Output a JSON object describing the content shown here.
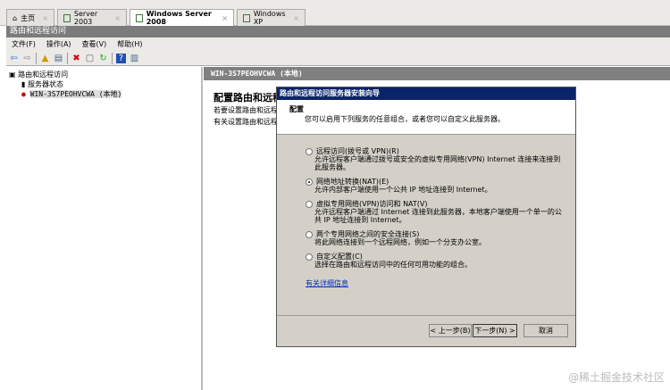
{
  "tabs": [
    {
      "label": "主页"
    },
    {
      "label": "Server 2003"
    },
    {
      "label": "Windows Server 2008"
    },
    {
      "label": "Windows XP"
    }
  ],
  "window_title": "路由和远程访问",
  "menu": [
    "文件(F)",
    "操作(A)",
    "查看(V)",
    "帮助(H)"
  ],
  "tree": {
    "root": "路由和远程访问",
    "items": [
      "服务器状态",
      "WIN-3S7PEOHVCWA (本地)"
    ]
  },
  "right": {
    "header": "WIN-3S7PEOHVCWA (本地)",
    "title": "配置路由和远程",
    "line1": "若要设置路由和远程",
    "line2": "有关设置路由和远程"
  },
  "dialog": {
    "title": "路由和远程访问服务器安装向导",
    "section": "配置",
    "subtitle": "您可以启用下列服务的任意组合，或者您可以自定义此服务器。",
    "options": [
      {
        "label": "远程访问(拨号或 VPN)(R)",
        "desc": "允许远程客户端通过拨号或安全的虚拟专用网络(VPN) Internet 连接来连接到此服务器。",
        "selected": false
      },
      {
        "label": "网络地址转换(NAT)(E)",
        "desc": "允许内部客户端使用一个公共 IP 地址连接到 Internet。",
        "selected": true
      },
      {
        "label": "虚拟专用网络(VPN)访问和 NAT(V)",
        "desc": "允许远程客户端通过 Internet 连接到此服务器，本地客户端使用一个单一的公共 IP 地址连接到 Internet。",
        "selected": false
      },
      {
        "label": "两个专用网络之间的安全连接(S)",
        "desc": "将此网络连接到一个远程网络，例如一个分支办公室。",
        "selected": false
      },
      {
        "label": "自定义配置(C)",
        "desc": "选择在路由和远程访问中的任何可用功能的组合。",
        "selected": false
      }
    ],
    "link": "有关详细信息",
    "back": "< 上一步(B)",
    "next": "下一步(N) >",
    "cancel": "取消"
  },
  "watermark": "@稀土掘金技术社区"
}
